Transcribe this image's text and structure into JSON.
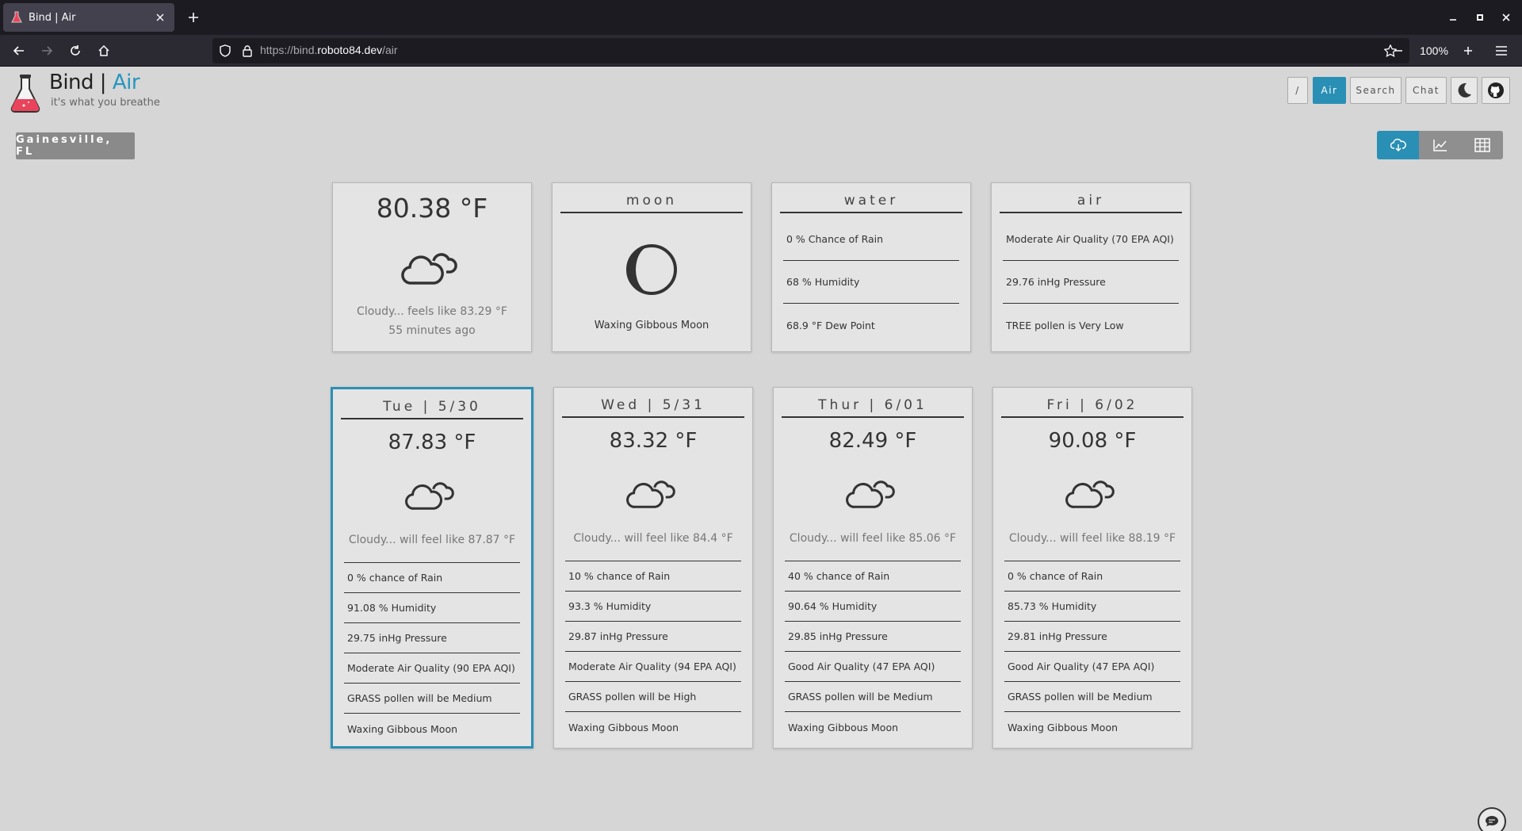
{
  "browser": {
    "tab_title": "Bind | Air",
    "url_prefix": "https://bind.",
    "url_domain": "roboto84.dev",
    "url_path": "/air",
    "zoom": "100%"
  },
  "header": {
    "brand_name": "Bind",
    "brand_sep": " | ",
    "brand_section": "Air",
    "tagline": "it's what you breathe",
    "accent_color": "#2596be"
  },
  "nav": {
    "slash": "/",
    "air": "Air",
    "search": "Search",
    "chat": "Chat"
  },
  "location": "Gainesville, FL",
  "current": {
    "temp": "80.38 °F",
    "desc": "Cloudy... feels like 83.29 °F",
    "updated": "55 minutes ago"
  },
  "moon": {
    "title": "moon",
    "phase": "Waxing Gibbous Moon"
  },
  "water": {
    "title": "water",
    "rows": [
      "0 % Chance of Rain",
      "68 % Humidity",
      "68.9 °F Dew Point"
    ]
  },
  "air": {
    "title": "air",
    "rows": [
      "Moderate Air Quality (70 EPA AQI)",
      "29.76 inHg Pressure",
      "TREE pollen is Very Low"
    ]
  },
  "forecast": [
    {
      "day": "Tue | 5/30",
      "temp": "87.83 °F",
      "desc": "Cloudy... will feel like 87.87 °F",
      "rows": [
        "0 % chance of Rain",
        "91.08 % Humidity",
        "29.75 inHg Pressure",
        "Moderate Air Quality (90 EPA AQI)",
        "GRASS pollen will be Medium",
        "Waxing Gibbous Moon"
      ]
    },
    {
      "day": "Wed | 5/31",
      "temp": "83.32 °F",
      "desc": "Cloudy... will feel like 84.4 °F",
      "rows": [
        "10 % chance of Rain",
        "93.3 % Humidity",
        "29.87 inHg Pressure",
        "Moderate Air Quality (94 EPA AQI)",
        "GRASS pollen will be High",
        "Waxing Gibbous Moon"
      ]
    },
    {
      "day": "Thur | 6/01",
      "temp": "82.49 °F",
      "desc": "Cloudy... will feel like 85.06 °F",
      "rows": [
        "40 % chance of Rain",
        "90.64 % Humidity",
        "29.85 inHg Pressure",
        "Good Air Quality (47 EPA AQI)",
        "GRASS pollen will be Medium",
        "Waxing Gibbous Moon"
      ]
    },
    {
      "day": "Fri | 6/02",
      "temp": "90.08 °F",
      "desc": "Cloudy... will feel like 88.19 °F",
      "rows": [
        "0 % chance of Rain",
        "85.73 % Humidity",
        "29.81 inHg Pressure",
        "Good Air Quality (47 EPA AQI)",
        "GRASS pollen will be Medium",
        "Waxing Gibbous Moon"
      ]
    }
  ]
}
